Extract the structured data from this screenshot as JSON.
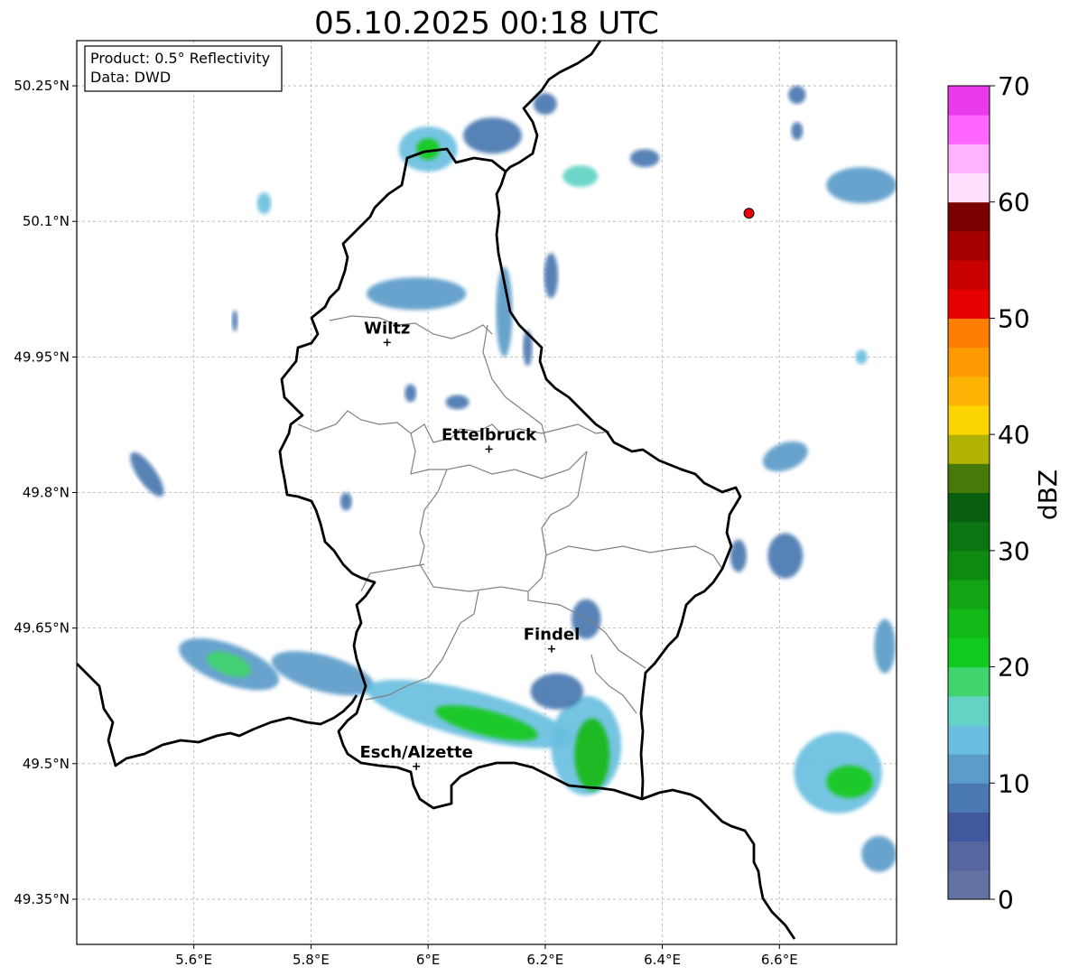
{
  "title": "05.10.2025 00:18 UTC",
  "info_box": {
    "line1": "Product: 0.5° Reflectivity",
    "line2": "Data: DWD"
  },
  "map": {
    "lon_range": [
      5.4,
      6.8
    ],
    "lat_range": [
      49.3,
      50.3
    ],
    "lon_ticks": [
      {
        "value": 5.6,
        "label": "5.6°E"
      },
      {
        "value": 5.8,
        "label": "5.8°E"
      },
      {
        "value": 6.0,
        "label": "6°E"
      },
      {
        "value": 6.2,
        "label": "6.2°E"
      },
      {
        "value": 6.4,
        "label": "6.4°E"
      },
      {
        "value": 6.6,
        "label": "6.6°E"
      }
    ],
    "lat_ticks": [
      {
        "value": 49.35,
        "label": "49.35°N"
      },
      {
        "value": 49.5,
        "label": "49.5°N"
      },
      {
        "value": 49.65,
        "label": "49.65°N"
      },
      {
        "value": 49.8,
        "label": "49.8°N"
      },
      {
        "value": 49.95,
        "label": "49.95°N"
      },
      {
        "value": 50.1,
        "label": "50.1°N"
      },
      {
        "value": 50.25,
        "label": "50.25°N"
      }
    ],
    "cities": [
      {
        "name": "Wiltz",
        "lon": 5.93,
        "lat": 49.966
      },
      {
        "name": "Ettelbruck",
        "lon": 6.104,
        "lat": 49.848
      },
      {
        "name": "Findel",
        "lon": 6.211,
        "lat": 49.627
      },
      {
        "name": "Esch/Alzette",
        "lon": 5.98,
        "lat": 49.497
      }
    ],
    "radar_site": {
      "lon": 6.548,
      "lat": 50.109,
      "color": "#e8000b"
    },
    "border_color": "#000000",
    "canton_color": "#808080"
  },
  "colorbar": {
    "label": "dBZ",
    "min": 0,
    "max": 70,
    "step": 2.5,
    "ticks": [
      0,
      10,
      20,
      30,
      40,
      50,
      60,
      70
    ],
    "colors": [
      "#6273a3",
      "#55679e",
      "#42599f",
      "#4a78b0",
      "#5b9cc9",
      "#6abfe0",
      "#62d3c5",
      "#40d46e",
      "#12c91e",
      "#13b919",
      "#12a414",
      "#0e8a10",
      "#0c7512",
      "#0a5e0f",
      "#487a0a",
      "#b1b204",
      "#fcd500",
      "#fdb404",
      "#fd9a02",
      "#ff7d00",
      "#e60000",
      "#c80000",
      "#a40000",
      "#7a0000",
      "#ffe0ff",
      "#ffb3ff",
      "#ff66ff",
      "#e83aeb"
    ]
  },
  "echoes": [
    {
      "lon": 5.66,
      "lat": 49.61,
      "rx": 0.09,
      "ry": 0.022,
      "rot": 20,
      "dbz": 12
    },
    {
      "lon": 5.66,
      "lat": 49.61,
      "rx": 0.04,
      "ry": 0.012,
      "rot": 20,
      "dbz": 18
    },
    {
      "lon": 5.82,
      "lat": 49.6,
      "rx": 0.09,
      "ry": 0.02,
      "rot": 15,
      "dbz": 11
    },
    {
      "lon": 5.52,
      "lat": 49.82,
      "rx": 0.045,
      "ry": 0.01,
      "rot": 55,
      "dbz": 8
    },
    {
      "lon": 6.07,
      "lat": 49.555,
      "rx": 0.18,
      "ry": 0.026,
      "rot": 14,
      "dbz": 13
    },
    {
      "lon": 6.1,
      "lat": 49.545,
      "rx": 0.09,
      "ry": 0.014,
      "rot": 14,
      "dbz": 21
    },
    {
      "lon": 6.27,
      "lat": 49.52,
      "rx": 0.06,
      "ry": 0.055,
      "rot": 0,
      "dbz": 14
    },
    {
      "lon": 6.28,
      "lat": 49.51,
      "rx": 0.03,
      "ry": 0.04,
      "rot": 0,
      "dbz": 24
    },
    {
      "lon": 6.22,
      "lat": 49.58,
      "rx": 0.045,
      "ry": 0.02,
      "rot": 0,
      "dbz": 9
    },
    {
      "lon": 6.27,
      "lat": 49.66,
      "rx": 0.025,
      "ry": 0.022,
      "rot": 0,
      "dbz": 8
    },
    {
      "lon": 6.0,
      "lat": 50.18,
      "rx": 0.05,
      "ry": 0.025,
      "rot": 0,
      "dbz": 13
    },
    {
      "lon": 6.0,
      "lat": 50.18,
      "rx": 0.02,
      "ry": 0.012,
      "rot": 0,
      "dbz": 21
    },
    {
      "lon": 6.11,
      "lat": 50.195,
      "rx": 0.05,
      "ry": 0.02,
      "rot": 0,
      "dbz": 9
    },
    {
      "lon": 5.98,
      "lat": 50.02,
      "rx": 0.085,
      "ry": 0.018,
      "rot": 0,
      "dbz": 12
    },
    {
      "lon": 6.13,
      "lat": 50.0,
      "rx": 0.014,
      "ry": 0.05,
      "rot": 0,
      "dbz": 12
    },
    {
      "lon": 6.2,
      "lat": 50.23,
      "rx": 0.02,
      "ry": 0.012,
      "rot": 0,
      "dbz": 9
    },
    {
      "lon": 6.26,
      "lat": 50.15,
      "rx": 0.03,
      "ry": 0.012,
      "rot": 0,
      "dbz": 15
    },
    {
      "lon": 6.37,
      "lat": 50.17,
      "rx": 0.025,
      "ry": 0.01,
      "rot": 0,
      "dbz": 8
    },
    {
      "lon": 6.21,
      "lat": 50.04,
      "rx": 0.012,
      "ry": 0.025,
      "rot": 0,
      "dbz": 8
    },
    {
      "lon": 6.74,
      "lat": 50.14,
      "rx": 0.06,
      "ry": 0.02,
      "rot": 0,
      "dbz": 11
    },
    {
      "lon": 6.63,
      "lat": 50.24,
      "rx": 0.015,
      "ry": 0.01,
      "rot": 0,
      "dbz": 8
    },
    {
      "lon": 6.63,
      "lat": 50.2,
      "rx": 0.01,
      "ry": 0.01,
      "rot": 0,
      "dbz": 8
    },
    {
      "lon": 5.72,
      "lat": 50.12,
      "rx": 0.012,
      "ry": 0.012,
      "rot": 0,
      "dbz": 14
    },
    {
      "lon": 6.61,
      "lat": 49.84,
      "rx": 0.04,
      "ry": 0.015,
      "rot": -20,
      "dbz": 11
    },
    {
      "lon": 6.61,
      "lat": 49.73,
      "rx": 0.03,
      "ry": 0.025,
      "rot": 0,
      "dbz": 8
    },
    {
      "lon": 6.53,
      "lat": 49.73,
      "rx": 0.014,
      "ry": 0.018,
      "rot": 0,
      "dbz": 8
    },
    {
      "lon": 6.7,
      "lat": 49.49,
      "rx": 0.075,
      "ry": 0.045,
      "rot": 0,
      "dbz": 13
    },
    {
      "lon": 6.72,
      "lat": 49.48,
      "rx": 0.04,
      "ry": 0.018,
      "rot": 0,
      "dbz": 20
    },
    {
      "lon": 6.77,
      "lat": 49.4,
      "rx": 0.03,
      "ry": 0.02,
      "rot": 0,
      "dbz": 10
    },
    {
      "lon": 6.78,
      "lat": 49.63,
      "rx": 0.018,
      "ry": 0.03,
      "rot": 0,
      "dbz": 12
    },
    {
      "lon": 6.74,
      "lat": 49.95,
      "rx": 0.01,
      "ry": 0.008,
      "rot": 0,
      "dbz": 13
    },
    {
      "lon": 6.05,
      "lat": 49.9,
      "rx": 0.02,
      "ry": 0.008,
      "rot": 0,
      "dbz": 8
    },
    {
      "lon": 5.97,
      "lat": 49.91,
      "rx": 0.01,
      "ry": 0.01,
      "rot": 0,
      "dbz": 8
    },
    {
      "lon": 5.86,
      "lat": 49.79,
      "rx": 0.01,
      "ry": 0.01,
      "rot": 0,
      "dbz": 8
    },
    {
      "lon": 5.67,
      "lat": 49.99,
      "rx": 0.005,
      "ry": 0.012,
      "rot": 0,
      "dbz": 8
    },
    {
      "lon": 6.17,
      "lat": 49.96,
      "rx": 0.008,
      "ry": 0.02,
      "rot": 0,
      "dbz": 8
    }
  ]
}
